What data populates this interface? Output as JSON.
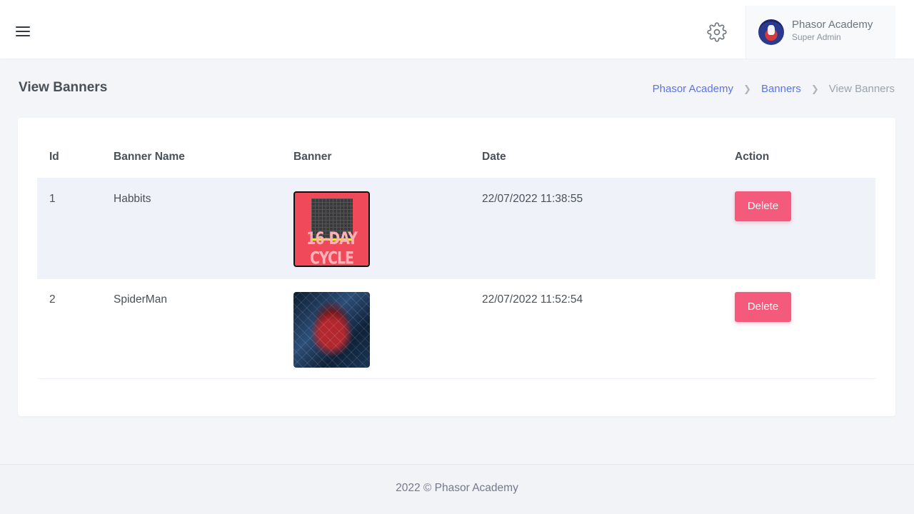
{
  "header": {
    "user": {
      "name": "Phasor Academy",
      "role": "Super Admin"
    }
  },
  "page": {
    "title": "View Banners",
    "breadcrumb": [
      "Phasor Academy",
      "Banners",
      "View Banners"
    ]
  },
  "table": {
    "columns": [
      "Id",
      "Banner Name",
      "Banner",
      "Date",
      "Action"
    ],
    "rows": [
      {
        "id": "1",
        "name": "Habbits",
        "banner_text": "16-DAY CYCLE",
        "date": "22/07/2022 11:38:55",
        "action": "Delete"
      },
      {
        "id": "2",
        "name": "SpiderMan",
        "banner_text": "",
        "date": "22/07/2022 11:52:54",
        "action": "Delete"
      }
    ]
  },
  "footer": {
    "text": "2022 © Phasor Academy"
  },
  "colors": {
    "accent": "#5b73e8",
    "danger": "#f35a7c",
    "row_highlight": "#f0f2f9"
  },
  "icons": [
    "menu-icon",
    "settings-gear-icon",
    "chevron-right-icon"
  ]
}
